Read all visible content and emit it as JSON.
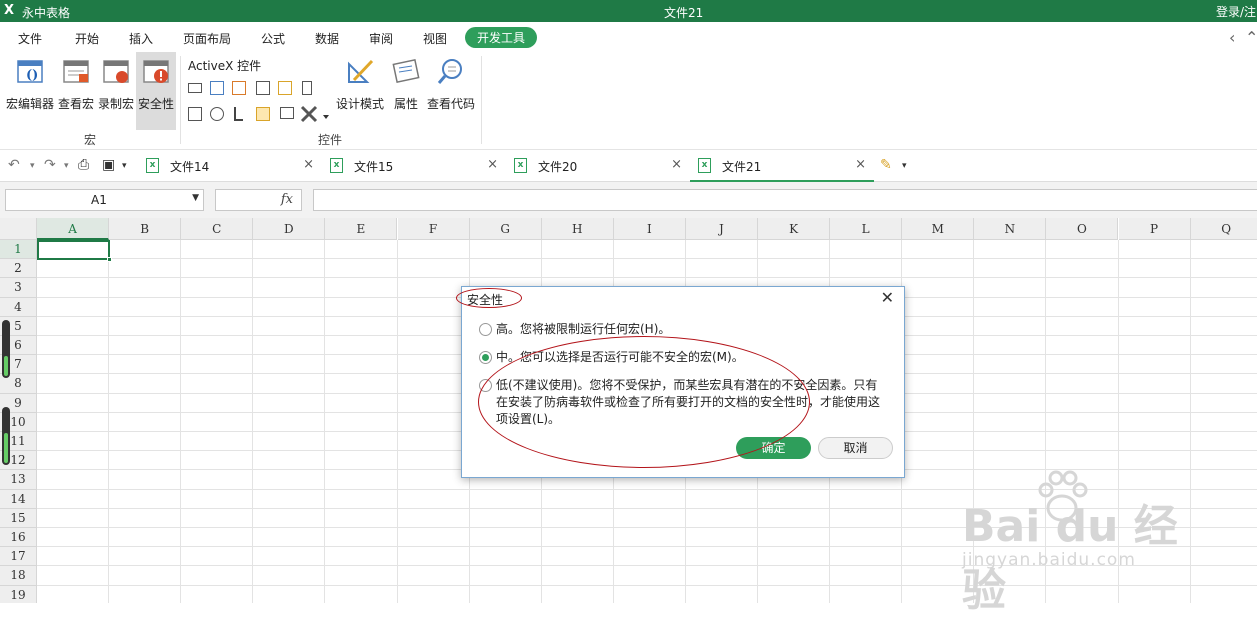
{
  "titlebar": {
    "logo": "X",
    "app_name": "永中表格",
    "doc_title": "文件21",
    "login": "登录/注"
  },
  "menu": {
    "items": [
      "文件",
      "开始",
      "插入",
      "页面布局",
      "公式",
      "数据",
      "审阅",
      "视图",
      "开发工具"
    ],
    "active": "开发工具",
    "back_arrow": "‹",
    "collapse_arrow": "⌃"
  },
  "ribbon": {
    "macro_group": {
      "label": "宏",
      "buttons": [
        "宏编辑器",
        "查看宏",
        "录制宏",
        "安全性"
      ],
      "selected": "安全性"
    },
    "controls_group": {
      "label": "控件",
      "activex_title": "ActiveX 控件",
      "buttons": [
        "设计模式",
        "属性",
        "查看代码"
      ]
    }
  },
  "tabs": {
    "items": [
      {
        "name": "文件14"
      },
      {
        "name": "文件15"
      },
      {
        "name": "文件20"
      },
      {
        "name": "文件21"
      }
    ],
    "active": "文件21",
    "close_glyph": "×",
    "xls_glyph": "x"
  },
  "formula_bar": {
    "name_box": "A1",
    "fx": "fx",
    "formula": ""
  },
  "sheet": {
    "columns": [
      "A",
      "B",
      "C",
      "D",
      "E",
      "F",
      "G",
      "H",
      "I",
      "J",
      "K",
      "L",
      "M",
      "N",
      "O",
      "P",
      "Q"
    ],
    "rows": [
      "1",
      "2",
      "3",
      "4",
      "5",
      "6",
      "7",
      "8",
      "9",
      "10",
      "11",
      "12",
      "13",
      "14",
      "15",
      "16",
      "17",
      "18",
      "19"
    ],
    "selected_cell": "A1"
  },
  "dialog": {
    "title": "安全性",
    "close": "✕",
    "options": [
      {
        "text": "高。您将被限制运行任何宏(H)。",
        "checked": false
      },
      {
        "text": "中。您可以选择是否运行可能不安全的宏(M)。",
        "checked": true
      },
      {
        "text": "低(不建议使用)。您将不受保护，而某些宏具有潜在的不安全因素。只有在安装了防病毒软件或检查了所有要打开的文档的安全性时，才能使用这项设置(L)。",
        "checked": false
      }
    ],
    "ok": "确定",
    "cancel": "取消"
  },
  "watermark": {
    "brand": "Bai du 经验",
    "url": "jingyan.baidu.com"
  },
  "colors": {
    "title_green": "#1f7a46",
    "accent_green": "#2e9e5b",
    "annotation_red": "#b3141a"
  }
}
